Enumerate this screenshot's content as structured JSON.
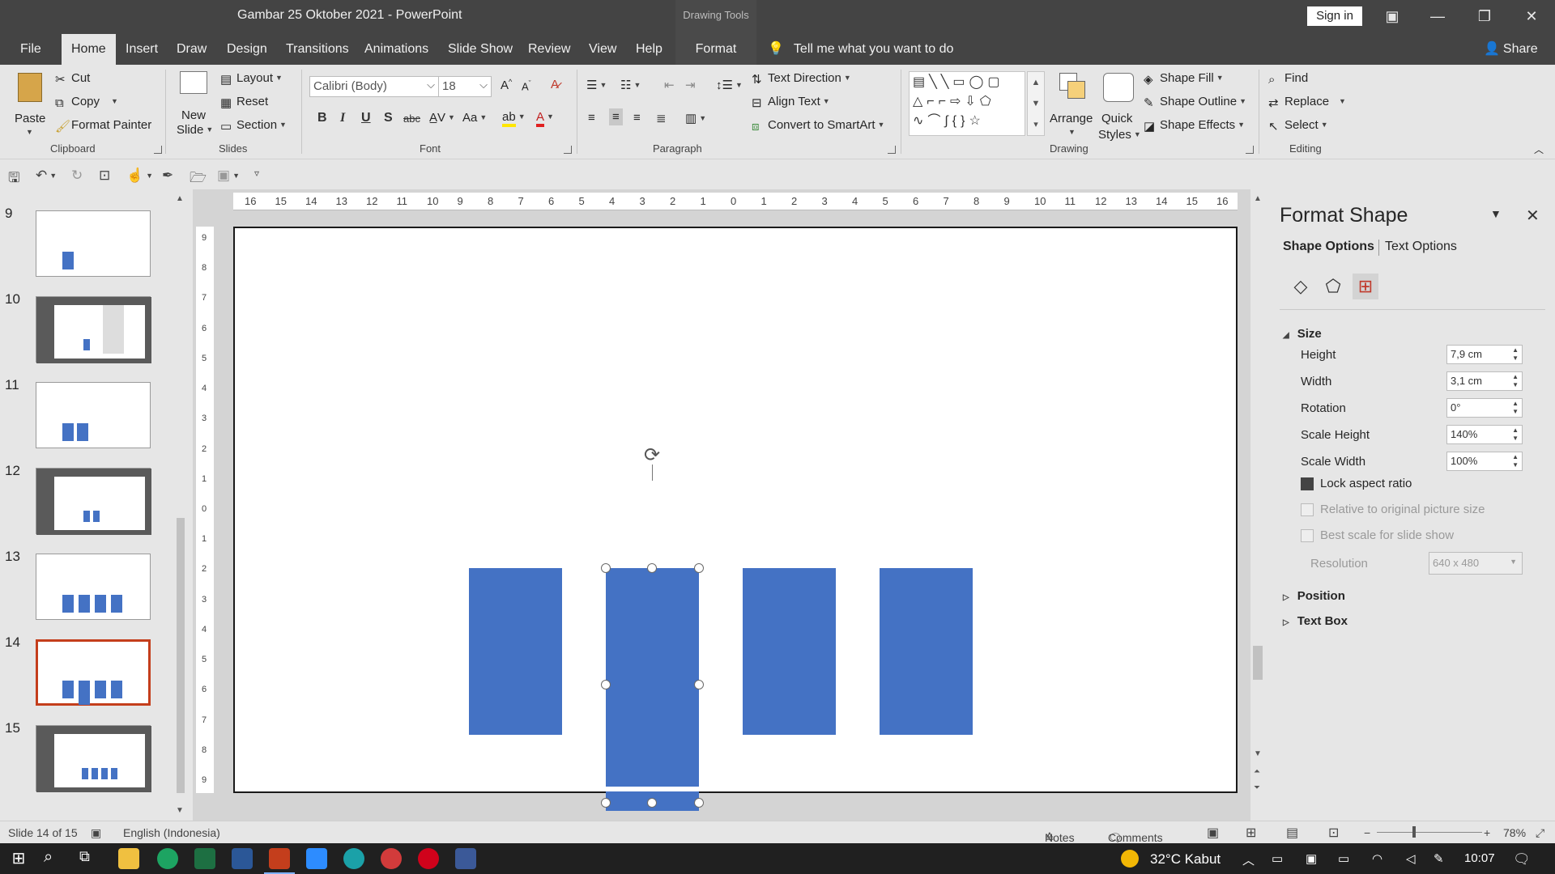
{
  "titlebar": {
    "title": "Gambar 25 Oktober 2021  -  PowerPoint",
    "drawing_tools": "Drawing Tools",
    "sign_in": "Sign in"
  },
  "tabs": [
    "File",
    "Home",
    "Insert",
    "Draw",
    "Design",
    "Transitions",
    "Animations",
    "Slide Show",
    "Review",
    "View",
    "Help",
    "Format"
  ],
  "tell_me": "Tell me what you want to do",
  "share": "Share",
  "ribbon": {
    "clipboard": {
      "label": "Clipboard",
      "paste": "Paste",
      "cut": "Cut",
      "copy": "Copy",
      "format_painter": "Format Painter"
    },
    "slides": {
      "label": "Slides",
      "new_slide_1": "New",
      "new_slide_2": "Slide",
      "layout": "Layout",
      "reset": "Reset",
      "section": "Section"
    },
    "font": {
      "label": "Font",
      "family": "Calibri (Body)",
      "size": "18",
      "change_case": "Aa"
    },
    "paragraph": {
      "label": "Paragraph",
      "text_direction": "Text Direction",
      "align_text": "Align Text",
      "convert_smartart": "Convert to SmartArt"
    },
    "drawing": {
      "label": "Drawing",
      "arrange": "Arrange",
      "quick_1": "Quick",
      "quick_2": "Styles",
      "shape_fill": "Shape Fill",
      "shape_outline": "Shape Outline",
      "shape_effects": "Shape Effects"
    },
    "editing": {
      "label": "Editing",
      "find": "Find",
      "replace": "Replace",
      "select": "Select"
    }
  },
  "slides_panel": {
    "numbers": [
      "9",
      "10",
      "11",
      "12",
      "13",
      "14",
      "15"
    ],
    "selected": "14"
  },
  "ruler": {
    "h_ticks": [
      "16",
      "15",
      "14",
      "13",
      "12",
      "11",
      "10",
      "9",
      "8",
      "7",
      "6",
      "5",
      "4",
      "3",
      "2",
      "1",
      "0",
      "1",
      "2",
      "3",
      "4",
      "5",
      "6",
      "7",
      "8",
      "9",
      "10",
      "11",
      "12",
      "13",
      "14",
      "15",
      "16"
    ],
    "v_ticks": [
      "9",
      "8",
      "7",
      "6",
      "5",
      "4",
      "3",
      "2",
      "1",
      "0",
      "1",
      "2",
      "3",
      "4",
      "5",
      "6",
      "7",
      "8",
      "9"
    ]
  },
  "format_pane": {
    "title": "Format Shape",
    "tab_shape": "Shape Options",
    "tab_text": "Text Options",
    "size_section": "Size",
    "height_label": "Height",
    "height_value": "7,9 cm",
    "width_label": "Width",
    "width_value": "3,1 cm",
    "rotation_label": "Rotation",
    "rotation_value": "0°",
    "scale_h_label": "Scale Height",
    "scale_h_value": "140%",
    "scale_w_label": "Scale Width",
    "scale_w_value": "100%",
    "lock_aspect": "Lock aspect ratio",
    "relative": "Relative to original picture size",
    "best_scale": "Best scale for slide show",
    "resolution_label": "Resolution",
    "resolution_value": "640 x 480",
    "position": "Position",
    "text_box": "Text Box"
  },
  "status": {
    "slide_info": "Slide 14 of 15",
    "language": "English (Indonesia)",
    "notes": "Notes",
    "comments": "Comments",
    "zoom": "78%"
  },
  "taskbar": {
    "weather": "32°C  Kabut",
    "time": "10:07"
  },
  "colors": {
    "shape_fill": "#4472c4",
    "selected_thumb": "#c43e1c",
    "chrome_dark": "#444444",
    "ribbon": "#e6e6e6"
  }
}
